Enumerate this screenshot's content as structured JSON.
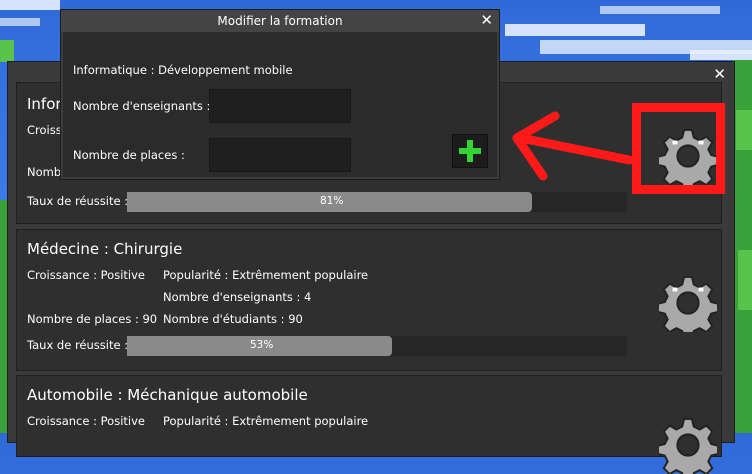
{
  "main_panel": {
    "close_glyph": "✕",
    "entries": [
      {
        "title": "Inform",
        "growth": "Croissan",
        "places": "Nombre",
        "success_label": "Taux de réussite :",
        "success_text": "81%",
        "success_value": 0.81
      },
      {
        "title": "Médecine : Chirurgie",
        "growth": "Croissance : Positive",
        "popularity": "Popularité : Extrêmement populaire",
        "teachers": "Nombre d'enseignants : 4",
        "places": "Nombre de places : 90",
        "students": "Nombre d'étudiants : 90",
        "success_label": "Taux de réussite :",
        "success_text": "53%",
        "success_value": 0.53
      },
      {
        "title": "Automobile : Méchanique automobile",
        "growth": "Croissance : Positive",
        "popularity": "Popularité : Extrêmement populaire"
      }
    ]
  },
  "dialog": {
    "title": "Modifier la formation",
    "close_glyph": "✕",
    "formation": "Informatique : Développement mobile",
    "teachers_label": "Nombre d'enseignants :",
    "teachers_value": "",
    "places_label": "Nombre de places :",
    "places_value": ""
  },
  "annotation": {
    "color": "#ff1a1a"
  },
  "icons": [
    "gear-icon",
    "plus-icon",
    "arrow-icon",
    "close-icon"
  ]
}
